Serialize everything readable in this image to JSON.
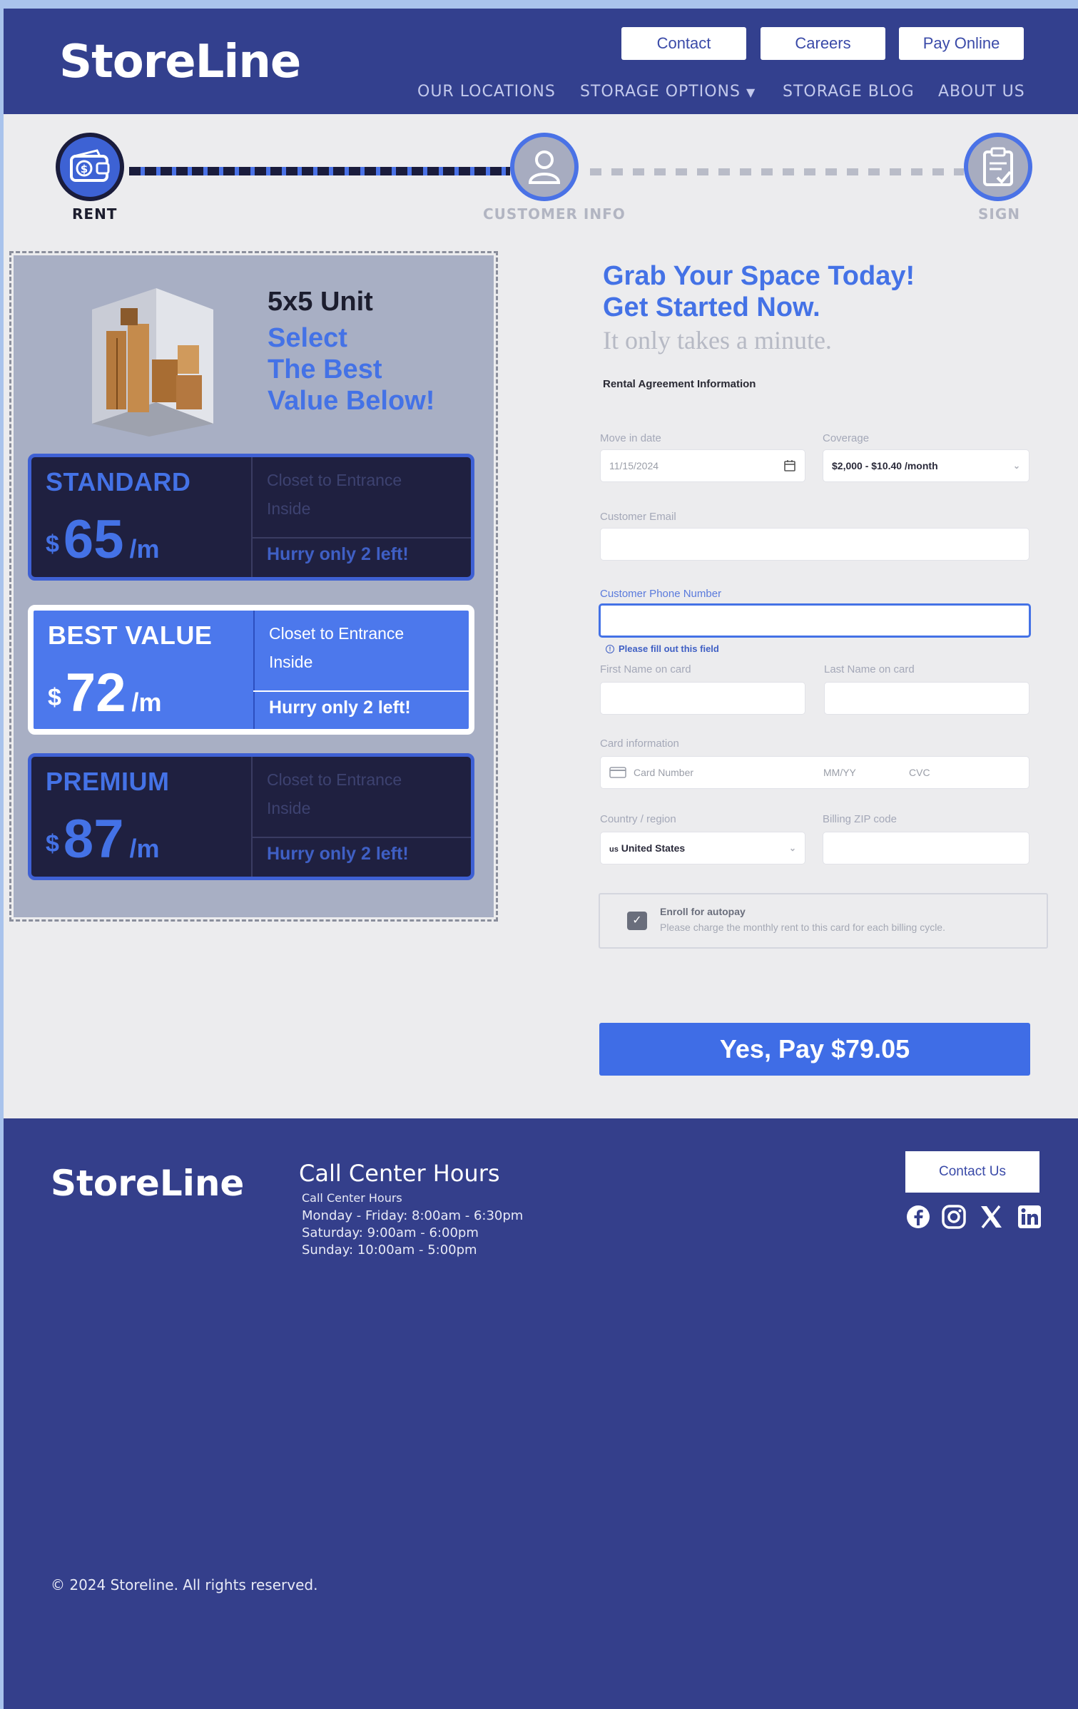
{
  "header": {
    "logo": "StoreLine",
    "buttons": [
      "Contact",
      "Careers",
      "Pay Online"
    ],
    "nav": {
      "locations": "OUR LOCATIONS",
      "storage": "STORAGE OPTIONS",
      "blog": "STORAGE BLOG",
      "about": "ABOUT US"
    }
  },
  "steps": [
    {
      "label": "RENT",
      "icon": "wallet-icon"
    },
    {
      "label": "CUSTOMER INFO",
      "icon": "user-icon"
    },
    {
      "label": "SIGN",
      "icon": "clipboard-check-icon"
    }
  ],
  "unit": {
    "title": "5x5 Unit",
    "sub": [
      "Select",
      "The Best",
      "Value Below!"
    ]
  },
  "tiers": [
    {
      "name": "STANDARD",
      "currency": "$",
      "price": "65",
      "per": "/m",
      "features": [
        "Closet to Entrance",
        "Inside"
      ],
      "hurry": "Hurry only 2 left!"
    },
    {
      "name": "BEST VALUE",
      "currency": "$",
      "price": "72",
      "per": "/m",
      "features": [
        "Closet to Entrance",
        "Inside"
      ],
      "hurry": "Hurry only 2 left!"
    },
    {
      "name": "PREMIUM",
      "currency": "$",
      "price": "87",
      "per": "/m",
      "features": [
        "Closet to Entrance",
        "Inside"
      ],
      "hurry": "Hurry only 2 left!"
    }
  ],
  "form": {
    "headline1": "Grab Your Space Today!",
    "headline2": "Get Started Now.",
    "subhead": "It only takes a minute.",
    "section": "Rental Agreement Information",
    "move_in_label": "Move in date",
    "move_in_value": "11/15/2024",
    "coverage_label": "Coverage",
    "coverage_value": "$2,000 - $10.40 /month",
    "email_label": "Customer Email",
    "phone_label": "Customer Phone Number",
    "phone_error": "Please fill out this field",
    "first_label": "First Name on card",
    "last_label": "Last Name on card",
    "card_label": "Card information",
    "card_number": "Card Number",
    "card_exp": "MM/YY",
    "card_cvc": "CVC",
    "country_label": "Country / region",
    "country_value": "United States",
    "zip_label": "Billing ZIP code",
    "autopay_title": "Enroll for autopay",
    "autopay_desc": "Please charge the monthly rent to this card for each billing cycle.",
    "pay_button": "Yes, Pay $79.05"
  },
  "footer": {
    "logo": "StoreLine",
    "cc_title": "Call Center Hours",
    "cc_lines": [
      "Call Center Hours",
      "Monday - Friday: 8:00am - 6:30pm",
      "Saturday: 9:00am - 6:00pm",
      "Sunday: 10:00am - 5:00pm"
    ],
    "contact_button": "Contact Us",
    "social": [
      "facebook-icon",
      "instagram-icon",
      "x-icon",
      "linkedin-icon"
    ],
    "copyright": "© 2024 Storeline. All rights reserved."
  }
}
